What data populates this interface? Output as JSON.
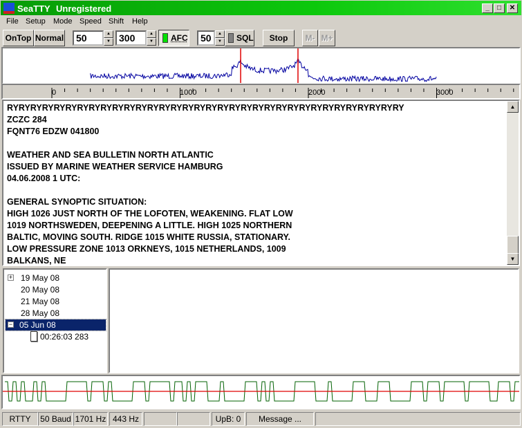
{
  "window": {
    "app_name": "SeaTTY",
    "registration": "Unregistered",
    "min": "_",
    "max": "□",
    "close": "✕"
  },
  "menu": [
    "File",
    "Setup",
    "Mode",
    "Speed",
    "Shift",
    "Help"
  ],
  "toolbar": {
    "ontop": "OnTop",
    "normal": "Normal",
    "field1": "50",
    "field2": "300",
    "afc": "AFC",
    "afc_on": true,
    "sql_level": "50",
    "sql": "SQL",
    "sql_on": false,
    "stop": "Stop",
    "mminus": "M-",
    "mplus": "M+"
  },
  "ruler": {
    "labels": [
      "0",
      "1000",
      "2000",
      "3000"
    ],
    "markers_hz": [
      1472,
      1919
    ]
  },
  "colors": {
    "spectrum": "#0000a0",
    "marker": "#e00000",
    "wave": "#006000",
    "afc_on": "#00e000"
  },
  "text_lines": [
    "RYRYRYRYRYRYRYRYRYRYRYRYRYRYRYRYRYRYRYRYRYRYRYRYRYRYRYRYRYRYRYRYRYRY",
    "ZCZC 284",
    "FQNT76 EDZW 041800",
    "",
    "WEATHER AND SEA BULLETIN NORTH ATLANTIC",
    "ISSUED BY MARINE WEATHER SERVICE HAMBURG",
    "04.06.2008 1 UTC:",
    "",
    "GENERAL SYNOPTIC SITUATION:",
    "HIGH 1026 JUST NORTH OF THE LOFOTEN, WEAKENING. FLAT LOW",
    "1019 NORTHSWEDEN, DEEPENING A LITTLE. HIGH 1025 NORTHERN",
    "BALTIC, MOVING SOUTH. RIDGE 1015 WHITE RUSSIA, STATIONARY.",
    "LOW PRESSURE ZONE 1013 ORKNEYS, 1015 NETHERLANDS, 1009",
    "BALKANS, NE"
  ],
  "tree": [
    {
      "label": "19 May 08",
      "expander": "+"
    },
    {
      "label": "20 May 08"
    },
    {
      "label": "21 May 08"
    },
    {
      "label": "28 May 08"
    },
    {
      "label": "05 Jun 08",
      "expander": "−",
      "selected": true
    },
    {
      "label": "00:26:03 283",
      "child": true
    }
  ],
  "status": [
    "RTTY",
    "50 Baud",
    "1701 Hz",
    "443 Hz",
    "",
    "",
    "UpB: 0",
    "Message ...",
    ""
  ]
}
